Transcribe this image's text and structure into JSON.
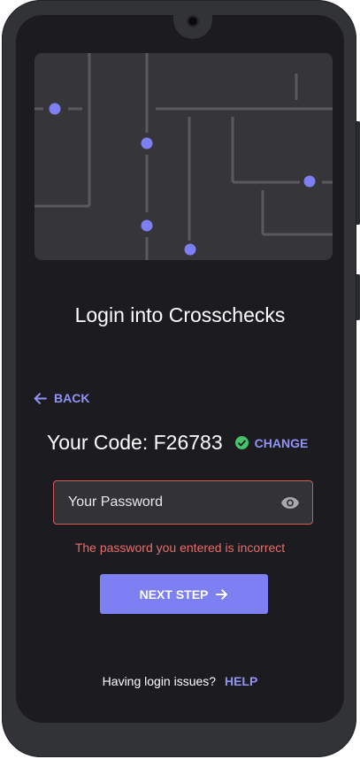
{
  "title": "Login into Crosschecks",
  "back": {
    "label": "BACK"
  },
  "code": {
    "text": "Your Code: F26783",
    "change_label": "CHANGE"
  },
  "password": {
    "label": "Your Password"
  },
  "error": {
    "message": "The password you entered is incorrect"
  },
  "next": {
    "label": "NEXT STEP"
  },
  "help": {
    "question": "Having login issues?",
    "link": "HELP"
  },
  "colors": {
    "accent": "#7d80f2",
    "link": "#8f94f5",
    "error": "#e86d6b",
    "success": "#45c46b",
    "background": "#1c1b1f"
  },
  "icons": [
    "back-arrow-icon",
    "check-circle-icon",
    "eye-icon",
    "forward-arrow-icon"
  ]
}
